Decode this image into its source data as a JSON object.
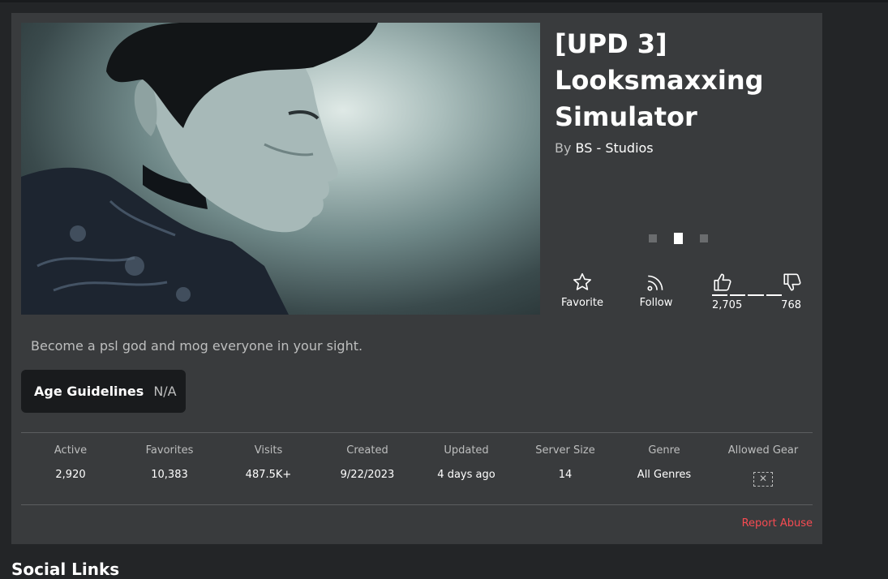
{
  "game": {
    "title": "[UPD 3] Looksmaxxing Simulator",
    "by_prefix": "By",
    "creator": "BS - Studios",
    "description": "Become a psl god and mog everyone in your sight."
  },
  "carousel": {
    "count": 3,
    "active_index": 1
  },
  "actions": {
    "favorite_label": "Favorite",
    "follow_label": "Follow"
  },
  "votes": {
    "up": "2,705",
    "down": "768"
  },
  "age": {
    "label": "Age Guidelines",
    "value": "N/A"
  },
  "stats": [
    {
      "label": "Active",
      "value": "2,920"
    },
    {
      "label": "Favorites",
      "value": "10,383"
    },
    {
      "label": "Visits",
      "value": "487.5K+"
    },
    {
      "label": "Created",
      "value": "9/22/2023"
    },
    {
      "label": "Updated",
      "value": "4 days ago"
    },
    {
      "label": "Server Size",
      "value": "14"
    },
    {
      "label": "Genre",
      "value": "All Genres"
    },
    {
      "label": "Allowed Gear",
      "icon": "gear-not-allowed-icon"
    }
  ],
  "report_label": "Report Abuse",
  "social_heading": "Social Links",
  "colors": {
    "card_bg": "#393b3d",
    "page_bg": "#232527",
    "report": "#f74b52"
  }
}
